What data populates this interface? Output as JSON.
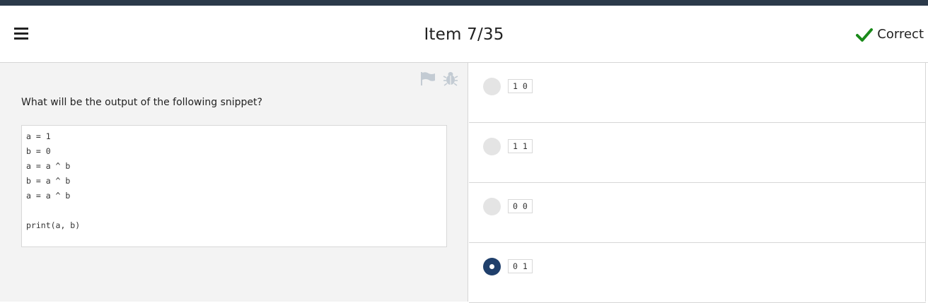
{
  "header": {
    "title": "Item 7/35",
    "status_label": "Correct",
    "status_color": "#1a8a1a"
  },
  "question": {
    "prompt": "What will be the output of the following snippet?",
    "code_lines": [
      "a = 1",
      "b = 0",
      "a = a ^ b",
      "b = a ^ b",
      "a = a ^ b",
      "",
      "print(a, b)"
    ]
  },
  "options": [
    {
      "label": "1 0",
      "selected": false
    },
    {
      "label": "1 1",
      "selected": false
    },
    {
      "label": "0 0",
      "selected": false
    },
    {
      "label": "0 1",
      "selected": true
    }
  ],
  "icons": [
    "menu-icon",
    "checkmark-icon",
    "flag-icon",
    "bug-icon"
  ],
  "colors": {
    "topbar": "#2b3a4a",
    "selected_radio": "#1f3f6b",
    "check": "#1a8a1a"
  }
}
